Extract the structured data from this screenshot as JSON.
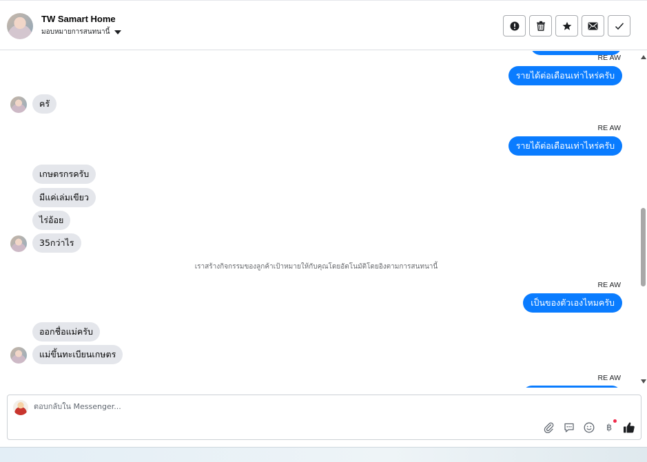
{
  "header": {
    "title": "TW Samart Home",
    "assign_label": "มอบหมายการสนทนานี้"
  },
  "actions": [
    {
      "name": "mark-spam-button",
      "icon": "exclamation-icon"
    },
    {
      "name": "delete-button",
      "icon": "trash-icon"
    },
    {
      "name": "star-button",
      "icon": "star-icon"
    },
    {
      "name": "mark-unread-button",
      "icon": "envelope-icon"
    },
    {
      "name": "mark-done-button",
      "icon": "check-icon"
    }
  ],
  "messages": {
    "sender_1": "RE AW",
    "out_1": "รายได้ต่อเดือนเท่าไหร่ครับ",
    "in_1": "ครั",
    "sender_2": "RE AW",
    "out_2": "รายได้ต่อเดือนเท่าไหร่ครับ",
    "in_2": "เกษตรกรครับ",
    "in_3": "มีแค่เล่มเขียว",
    "in_4": "ไร่อ้อย",
    "in_5": "35กว่าไร",
    "notice": "เราสร้างกิจกรรมของลูกค้าเป้าหมายให้กับคุณโดยอัตโนมัติโดยอิงตามการสนทนานี้",
    "sender_3": "RE AW",
    "out_3": "เป็นของตัวเองไหมครับ",
    "in_6": "ออกชื่อแม่ครับ",
    "in_7": "แม่ขึ้นทะเบียนเกษตร",
    "sender_4": "RE AW"
  },
  "composer": {
    "placeholder": "ตอบกลับใน Messenger...",
    "currency_symbol": "฿"
  },
  "colors": {
    "outgoing_bubble": "#0a7cff",
    "incoming_bubble": "#e4e6eb",
    "notification_dot": "#f02849"
  }
}
